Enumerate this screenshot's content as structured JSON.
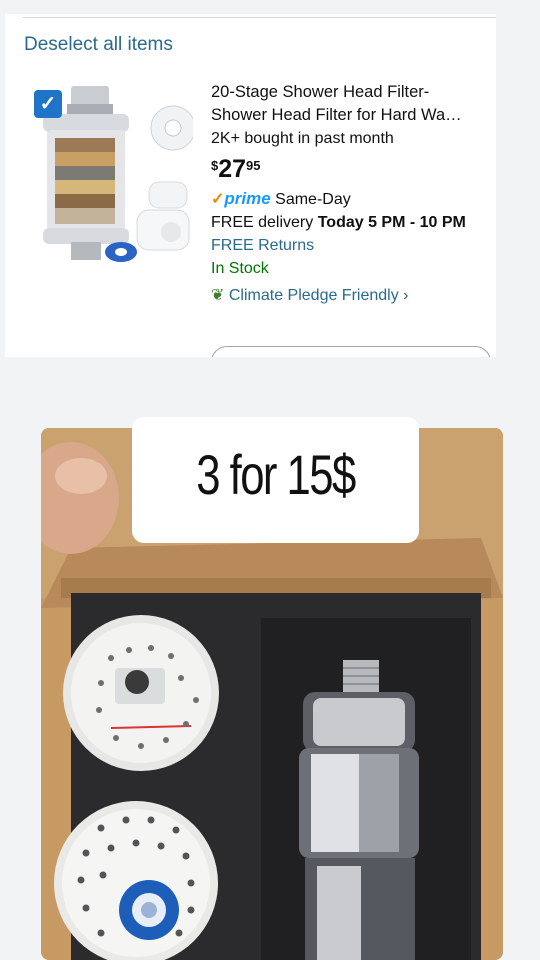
{
  "cart": {
    "deselect_label": "Deselect all items",
    "item": {
      "checked": true,
      "title_line1": "20-Stage Shower Head Filter-",
      "title_line2": "Shower Head Filter for Hard Wa…",
      "bought": "2K+ bought in past month",
      "price_symbol": "$",
      "price_whole": "27",
      "price_fraction": "95",
      "prime_check": "✓",
      "prime_label": "prime",
      "prime_speed": "Same-Day",
      "delivery_prefix": "FREE delivery ",
      "delivery_time": "Today 5 PM - 10 PM",
      "returns": "FREE Returns",
      "stock": "In Stock",
      "climate": "Climate Pledge Friendly",
      "climate_chevron": "›"
    }
  },
  "overlay": {
    "caption": "3 for 15$"
  },
  "colors": {
    "link": "#2a6a8e",
    "stock": "#007600",
    "prime_blue": "#1a98ff",
    "checkbox": "#1f74c7"
  }
}
